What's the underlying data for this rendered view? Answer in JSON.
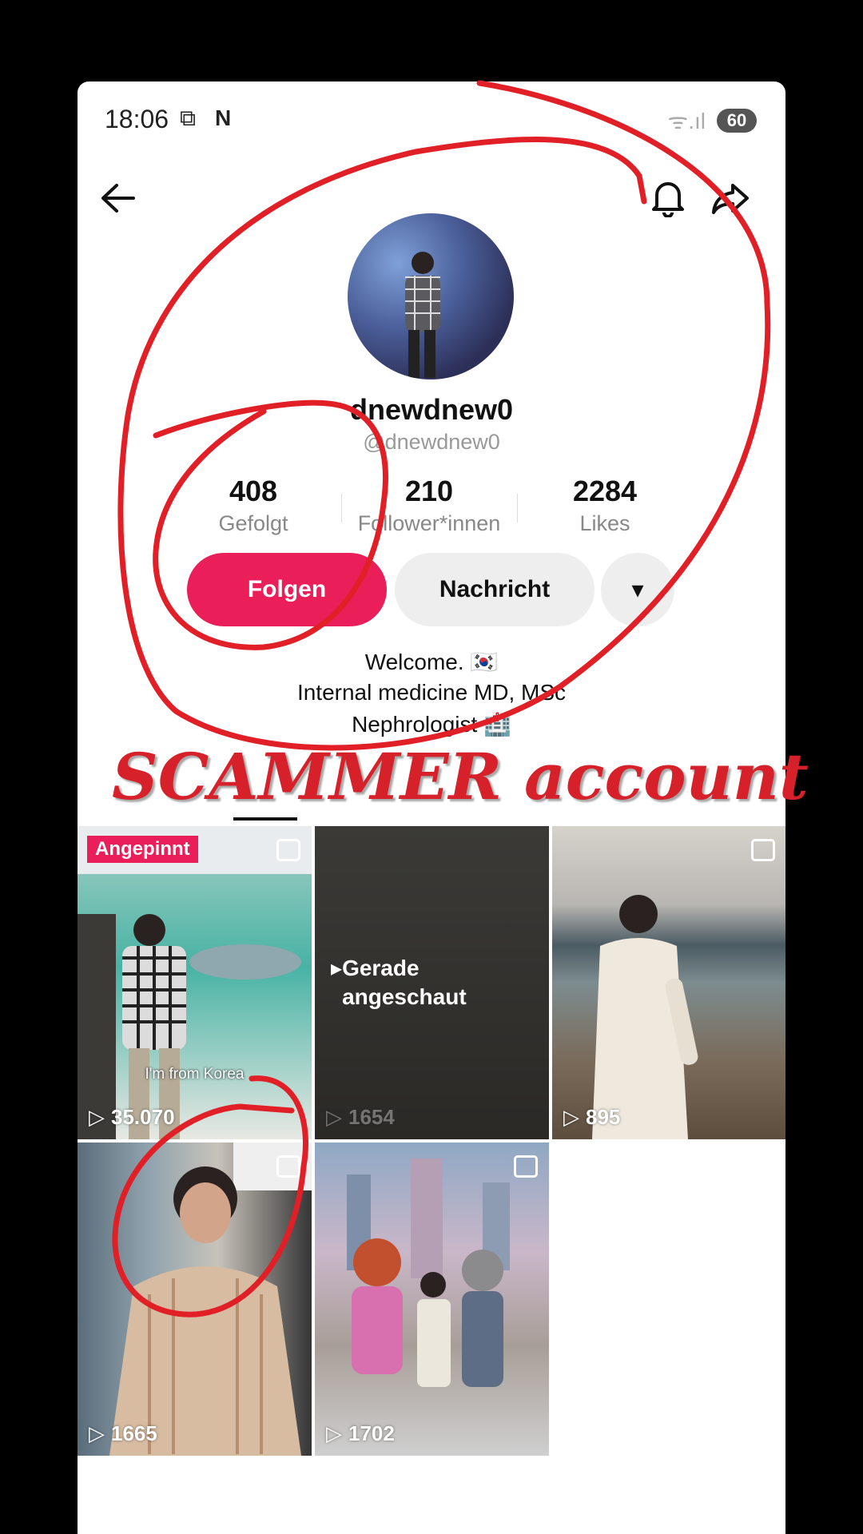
{
  "status_bar": {
    "time": "18:06",
    "battery": "60"
  },
  "profile": {
    "display_name": "dnewdnew0",
    "handle": "@dnewdnew0",
    "stats": [
      {
        "value": "408",
        "label": "Gefolgt"
      },
      {
        "value": "210",
        "label": "Follower*innen"
      },
      {
        "value": "2284",
        "label": "Likes"
      }
    ],
    "buttons": {
      "follow": "Folgen",
      "message": "Nachricht",
      "more": "▾"
    },
    "bio": [
      "Welcome. 🇰🇷",
      "Internal medicine MD, MSc",
      "Nephrologist 🏥"
    ]
  },
  "videos": [
    {
      "pinned_label": "Angepinnt",
      "caption": "I'm from Korea",
      "views": "35.070"
    },
    {
      "overlay_text": "Gerade angeschaut",
      "views": "1654"
    },
    {
      "views": "895"
    },
    {
      "views": "1665"
    },
    {
      "views": "1702"
    }
  ],
  "annotation": {
    "text": "SCAMMER account",
    "color": "#d6212b"
  },
  "colors": {
    "accent": "#ea1f5a"
  }
}
